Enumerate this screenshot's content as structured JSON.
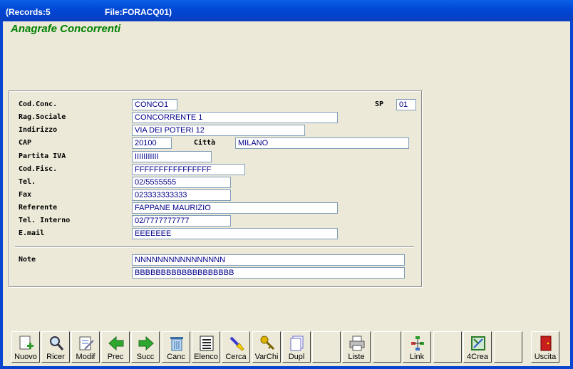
{
  "titlebar": {
    "records": "(Records:5",
    "file": "File:FORACQ01)"
  },
  "form": {
    "title": "Anagrafe Concorrenti",
    "fields": {
      "cod_conc": {
        "label": "Cod.Conc.",
        "value": "CONCO1"
      },
      "sp": {
        "label": "SP",
        "value": "01"
      },
      "rag_sociale": {
        "label": "Rag.Sociale",
        "value": "CONCORRENTE 1"
      },
      "indirizzo": {
        "label": "Indirizzo",
        "value": "VIA DEI POTERI 12"
      },
      "cap": {
        "label": "CAP",
        "value": "20100"
      },
      "citta": {
        "label": "Città",
        "value": "MILANO"
      },
      "partita_iva": {
        "label": "Partita IVA",
        "value": "IIIIIIIIIII"
      },
      "cod_fisc": {
        "label": "Cod.Fisc.",
        "value": "FFFFFFFFFFFFFFFF"
      },
      "tel": {
        "label": "Tel.",
        "value": "02/5555555"
      },
      "fax": {
        "label": "Fax",
        "value": "023333333333"
      },
      "referente": {
        "label": "Referente",
        "value": "FAPPANE MAURIZIO"
      },
      "tel_interno": {
        "label": "Tel. Interno",
        "value": "02/7777777777"
      },
      "email": {
        "label": "E.mail",
        "value": "EEEEEEE"
      },
      "note": {
        "label": "Note",
        "line1": "NNNNNNNNNNNNNNNN",
        "line2": "BBBBBBBBBBBBBBBBBBB"
      }
    }
  },
  "toolbar": {
    "buttons": [
      {
        "label": "Nuovo",
        "icon": "new-document-icon"
      },
      {
        "label": "Ricer",
        "icon": "search-magnifier-icon"
      },
      {
        "label": "Modif",
        "icon": "edit-document-icon"
      },
      {
        "label": "Prec",
        "icon": "arrow-left-icon"
      },
      {
        "label": "Succ",
        "icon": "arrow-right-icon"
      },
      {
        "label": "Canc",
        "icon": "trash-icon"
      },
      {
        "label": "Elenco",
        "icon": "list-icon"
      },
      {
        "label": "Cerca",
        "icon": "flashlight-icon"
      },
      {
        "label": "VarChi",
        "icon": "keys-icon"
      },
      {
        "label": "Dupl",
        "icon": "duplicate-icon"
      },
      {
        "label": "Liste",
        "icon": "printer-icon"
      },
      {
        "label": "Link",
        "icon": "tree-icon"
      },
      {
        "label": "4Crea",
        "icon": "4crea-icon"
      },
      {
        "label": "Uscita",
        "icon": "exit-door-icon"
      }
    ]
  },
  "colors": {
    "title_green": "#008000",
    "field_text": "#00008b",
    "window_bg": "#ece9d8",
    "titlebar_blue": "#0046d5"
  }
}
